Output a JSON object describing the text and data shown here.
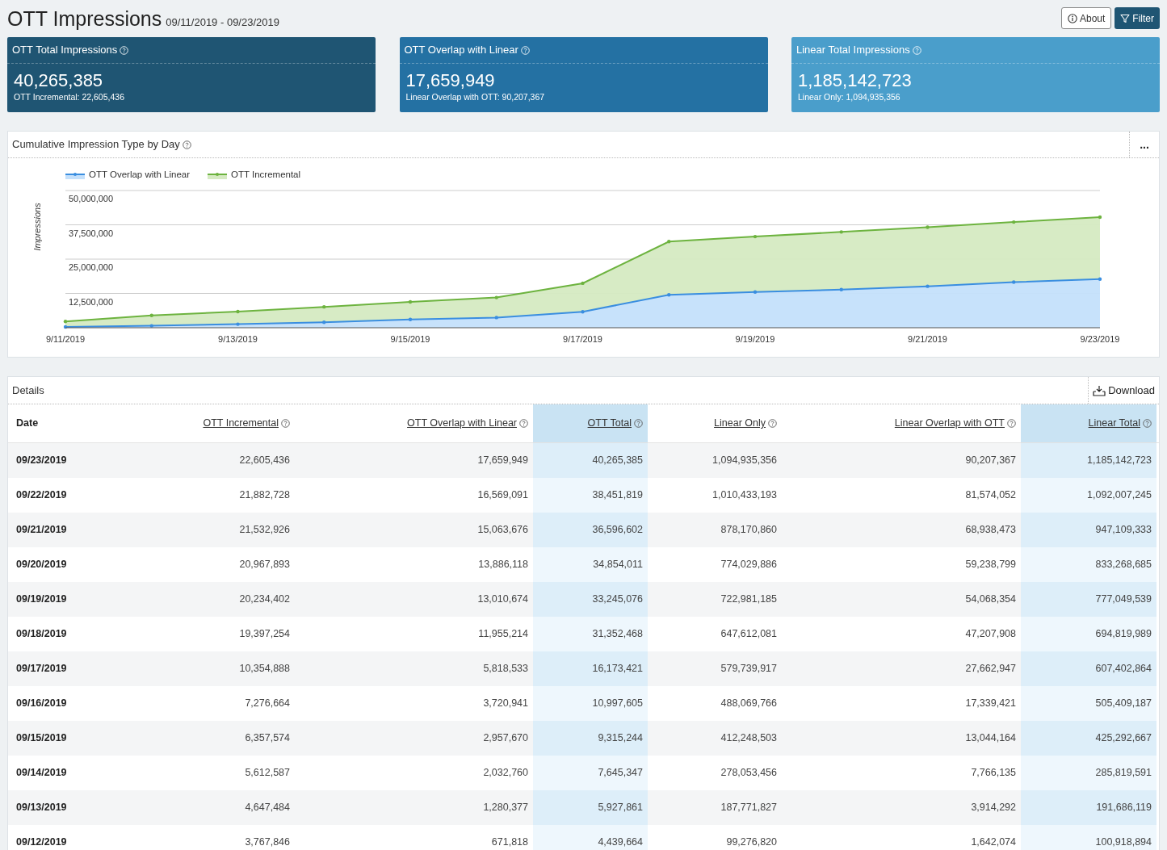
{
  "header": {
    "title": "OTT Impressions",
    "date_range": "09/11/2019 - 09/23/2019"
  },
  "buttons": [
    {
      "label": "About",
      "kind": "about"
    },
    {
      "label": "Filter",
      "kind": "filter"
    }
  ],
  "cards": [
    {
      "title": "OTT Total Impressions",
      "value": "40,265,385",
      "subtitle": "OTT Incremental: 22,605,436",
      "color": "#1f5573"
    },
    {
      "title": "OTT Overlap with Linear",
      "value": "17,659,949",
      "subtitle": "Linear Overlap with OTT: 90,207,367",
      "color": "#2471a3"
    },
    {
      "title": "Linear Total Impressions",
      "value": "1,185,142,723",
      "subtitle": "Linear Only: 1,094,935,356",
      "color": "#4a9ecb"
    }
  ],
  "chart_panel": {
    "title": "Cumulative Impression Type by Day",
    "menu": "...",
    "chart_data": {
      "type": "area",
      "stacked": true,
      "ylabel": "Impressions",
      "x": [
        "9/11/2019",
        null,
        "9/13/2019",
        null,
        "9/15/2019",
        null,
        "9/17/2019",
        null,
        "9/19/2019",
        null,
        "9/21/2019",
        null,
        "9/23/2019"
      ],
      "grid": true,
      "legend": true,
      "series": [
        {
          "name": "OTT Overlap with Linear",
          "color": "#3a8ee0",
          "values": [
            300000,
            700000,
            1300000,
            2000000,
            3000000,
            3700000,
            5800000,
            12000000,
            13000000,
            13900000,
            15100000,
            16600000,
            17700000
          ]
        },
        {
          "name": "OTT Incremental",
          "color": "#6db33f",
          "values": [
            2000000,
            3800000,
            4600000,
            5600000,
            6400000,
            7300000,
            10400000,
            19400000,
            20200000,
            21000000,
            21500000,
            21900000,
            22600000
          ]
        }
      ],
      "ylim": [
        0,
        50000000
      ],
      "yticks": [
        {
          "value": 12500000,
          "label": "12,500,000"
        },
        {
          "value": 25000000,
          "label": "25,000,000"
        },
        {
          "value": 37500000,
          "label": "37,500,000"
        },
        {
          "value": 50000000,
          "label": "50,000,000"
        }
      ]
    }
  },
  "details": {
    "title": "Details",
    "download": "Download",
    "columns": [
      {
        "label": "Date",
        "kind": "plain",
        "highlighted": false
      },
      {
        "label": "OTT Incremental",
        "kind": "link",
        "highlighted": false
      },
      {
        "label": "OTT Overlap with Linear",
        "kind": "link",
        "highlighted": false
      },
      {
        "label": "OTT Total",
        "kind": "link",
        "highlighted": true
      },
      {
        "label": "Linear Only",
        "kind": "link",
        "highlighted": false
      },
      {
        "label": "Linear Overlap with OTT",
        "kind": "link",
        "highlighted": false
      },
      {
        "label": "Linear Total",
        "kind": "link",
        "highlighted": true
      }
    ],
    "rows": [
      [
        "09/23/2019",
        "22,605,436",
        "17,659,949",
        "40,265,385",
        "1,094,935,356",
        "90,207,367",
        "1,185,142,723"
      ],
      [
        "09/22/2019",
        "21,882,728",
        "16,569,091",
        "38,451,819",
        "1,010,433,193",
        "81,574,052",
        "1,092,007,245"
      ],
      [
        "09/21/2019",
        "21,532,926",
        "15,063,676",
        "36,596,602",
        "878,170,860",
        "68,938,473",
        "947,109,333"
      ],
      [
        "09/20/2019",
        "20,967,893",
        "13,886,118",
        "34,854,011",
        "774,029,886",
        "59,238,799",
        "833,268,685"
      ],
      [
        "09/19/2019",
        "20,234,402",
        "13,010,674",
        "33,245,076",
        "722,981,185",
        "54,068,354",
        "777,049,539"
      ],
      [
        "09/18/2019",
        "19,397,254",
        "11,955,214",
        "31,352,468",
        "647,612,081",
        "47,207,908",
        "694,819,989"
      ],
      [
        "09/17/2019",
        "10,354,888",
        "5,818,533",
        "16,173,421",
        "579,739,917",
        "27,662,947",
        "607,402,864"
      ],
      [
        "09/16/2019",
        "7,276,664",
        "3,720,941",
        "10,997,605",
        "488,069,766",
        "17,339,421",
        "505,409,187"
      ],
      [
        "09/15/2019",
        "6,357,574",
        "2,957,670",
        "9,315,244",
        "412,248,503",
        "13,044,164",
        "425,292,667"
      ],
      [
        "09/14/2019",
        "5,612,587",
        "2,032,760",
        "7,645,347",
        "278,053,456",
        "7,766,135",
        "285,819,591"
      ],
      [
        "09/13/2019",
        "4,647,484",
        "1,280,377",
        "5,927,861",
        "187,771,827",
        "3,914,292",
        "191,686,119"
      ],
      [
        "09/12/2019",
        "3,767,846",
        "671,818",
        "4,439,664",
        "99,276,820",
        "1,642,074",
        "100,918,894"
      ]
    ]
  }
}
